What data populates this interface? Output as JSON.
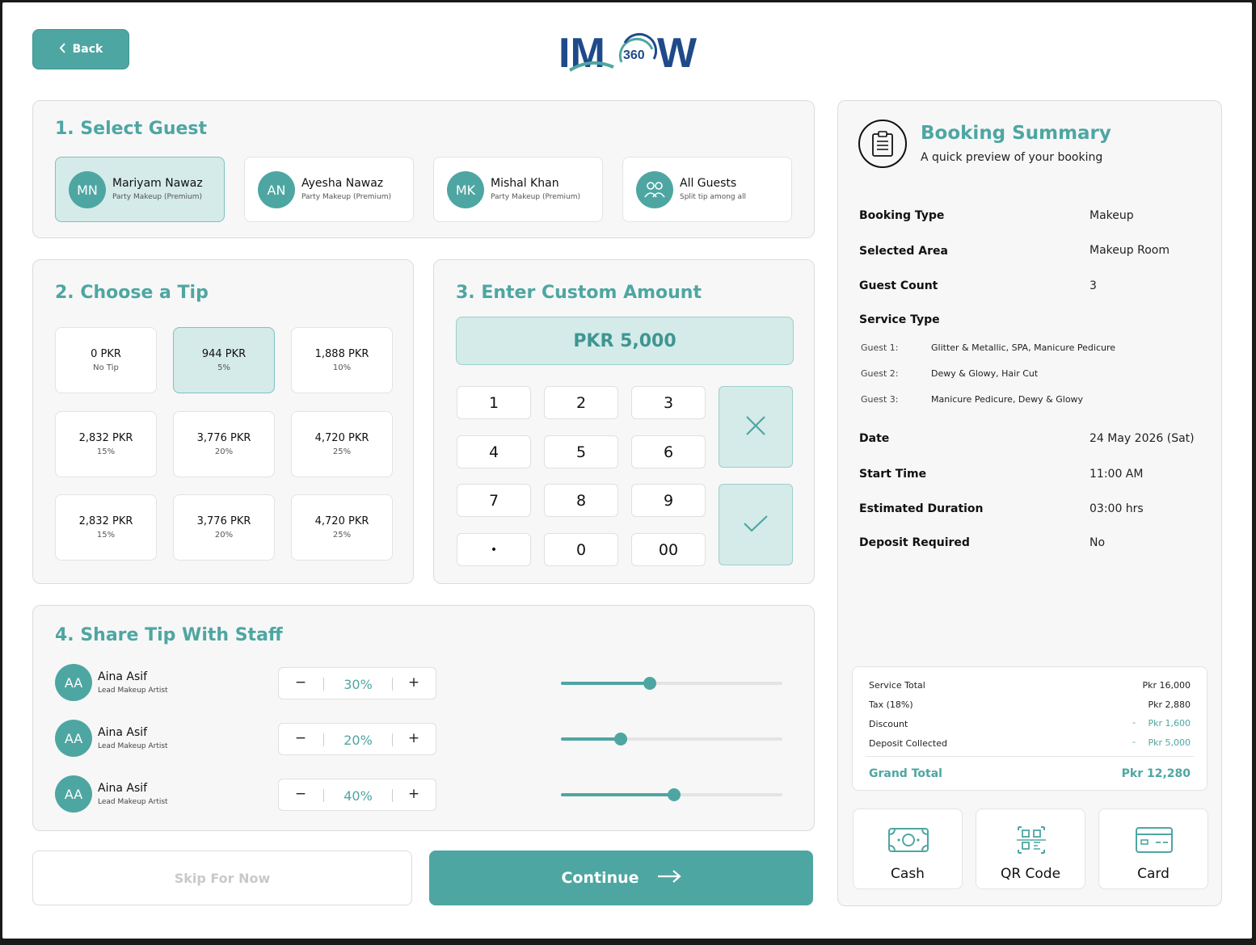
{
  "header": {
    "back_label": "Back",
    "logo_text_left": "IM",
    "logo_badge": "360",
    "logo_text_right": "W"
  },
  "select_guest": {
    "title": "1. Select Guest",
    "guests": [
      {
        "initials": "MN",
        "name": "Mariyam Nawaz",
        "sub": "Party Makeup (Premium)",
        "selected": true
      },
      {
        "initials": "AN",
        "name": "Ayesha Nawaz",
        "sub": "Party Makeup (Premium)",
        "selected": false
      },
      {
        "initials": "MK",
        "name": "Mishal Khan",
        "sub": "Party Makeup (Premium)",
        "selected": false
      },
      {
        "initials": "",
        "name": "All Guests",
        "sub": "Split tip among all",
        "selected": false
      }
    ]
  },
  "choose_tip": {
    "title": "2. Choose a Tip",
    "options": [
      {
        "value": "0 PKR",
        "pct": "No Tip",
        "selected": false
      },
      {
        "value": "944 PKR",
        "pct": "5%",
        "selected": true
      },
      {
        "value": "1,888 PKR",
        "pct": "10%",
        "selected": false
      },
      {
        "value": "2,832 PKR",
        "pct": "15%",
        "selected": false
      },
      {
        "value": "3,776 PKR",
        "pct": "20%",
        "selected": false
      },
      {
        "value": "4,720 PKR",
        "pct": "25%",
        "selected": false
      },
      {
        "value": "2,832 PKR",
        "pct": "15%",
        "selected": false
      },
      {
        "value": "3,776 PKR",
        "pct": "20%",
        "selected": false
      },
      {
        "value": "4,720 PKR",
        "pct": "25%",
        "selected": false
      }
    ]
  },
  "custom_amount": {
    "title": "3. Enter Custom Amount",
    "amount": "PKR 5,000",
    "keys": [
      "1",
      "2",
      "3",
      "4",
      "5",
      "6",
      "7",
      "8",
      "9",
      "•",
      "0",
      "00"
    ]
  },
  "share_tip": {
    "title": "4. Share Tip With Staff",
    "staff": [
      {
        "initials": "AA",
        "name": "Aina Asif",
        "role": "Lead Makeup Artist",
        "percent": "30%",
        "slider_value": 0.4
      },
      {
        "initials": "AA",
        "name": "Aina Asif",
        "role": "Lead Makeup Artist",
        "percent": "20%",
        "slider_value": 0.27
      },
      {
        "initials": "AA",
        "name": "Aina Asif",
        "role": "Lead Makeup Artist",
        "percent": "40%",
        "slider_value": 0.51
      }
    ],
    "minus": "−",
    "plus": "+"
  },
  "actions": {
    "skip_label": "Skip For Now",
    "continue_label": "Continue"
  },
  "summary": {
    "title": "Booking Summary",
    "subtitle": "A quick preview of your booking",
    "rows_top": [
      {
        "label": "Booking Type",
        "value": "Makeup"
      },
      {
        "label": "Selected Area",
        "value": "Makeup Room"
      },
      {
        "label": "Guest Count",
        "value": "3"
      }
    ],
    "service_type_label": "Service Type",
    "services": [
      {
        "guest": "Guest 1:",
        "list": "Glitter & Metallic, SPA, Manicure Pedicure"
      },
      {
        "guest": "Guest 2:",
        "list": "Dewy & Glowy, Hair Cut"
      },
      {
        "guest": "Guest 3:",
        "list": "Manicure Pedicure, Dewy & Glowy"
      }
    ],
    "rows_bottom": [
      {
        "label": "Date",
        "value": "24 May 2026 (Sat)"
      },
      {
        "label": "Start Time",
        "value": "11:00 AM"
      },
      {
        "label": "Estimated Duration",
        "value": "03:00 hrs"
      },
      {
        "label": "Deposit Required",
        "value": "No"
      }
    ],
    "totals": [
      {
        "label": "Service Total",
        "value": "Pkr 16,000",
        "dash": ""
      },
      {
        "label": "Tax (18%)",
        "value": "Pkr 2,880",
        "dash": ""
      },
      {
        "label": "Discount",
        "value": "Pkr 1,600",
        "dash": "-"
      },
      {
        "label": "Deposit Collected",
        "value": "Pkr 5,000",
        "dash": "-"
      }
    ],
    "grand_total_label": "Grand Total",
    "grand_total_value": "Pkr 12,280",
    "payment_methods": [
      "Cash",
      "QR Code",
      "Card"
    ]
  },
  "colors": {
    "accent": "#4ea6a2",
    "selected_bg": "#d4ebe9",
    "logo_blue": "#1e4a8a"
  }
}
